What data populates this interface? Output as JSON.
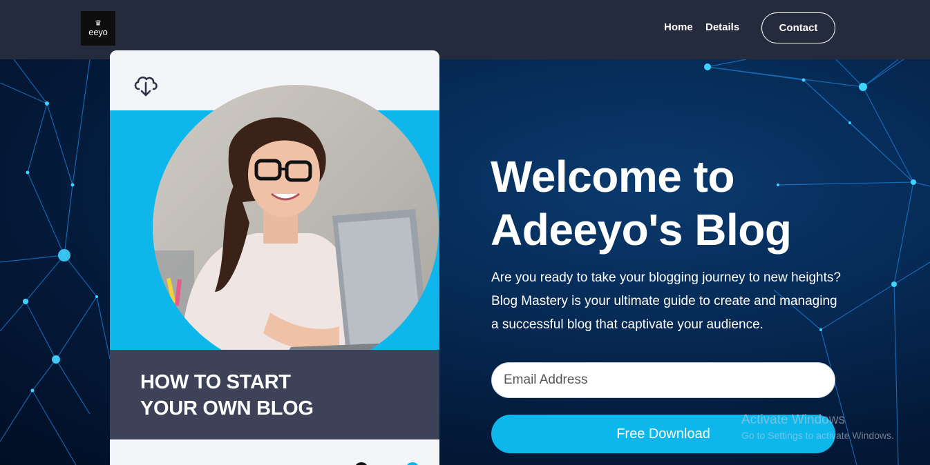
{
  "header": {
    "logo_text": "eeyo",
    "nav": [
      {
        "label": "Home"
      },
      {
        "label": "Details"
      }
    ],
    "contact_label": "Contact"
  },
  "card": {
    "download_icon": "cloud-download-icon",
    "headline": "HOW TO START\nYOUR OWN BLOG",
    "photo": "woman-with-laptop-photo"
  },
  "hero": {
    "title_line1": "Welcome to",
    "title_line2": "Adeeyo's Blog",
    "description": "Are you ready to take your blogging journey to new heights? Blog Mastery is your ultimate guide to create and managing a successful blog that captivate your audience.",
    "email_placeholder": "Email Address",
    "button_label": "Free Download"
  },
  "watermark": {
    "title": "Activate Windows",
    "subtitle": "Go to Settings to activate Windows."
  },
  "colors": {
    "accent": "#0eb7eb",
    "header_bg": "#242b3d",
    "card_dark": "#3d4258",
    "background": "#062a55"
  }
}
